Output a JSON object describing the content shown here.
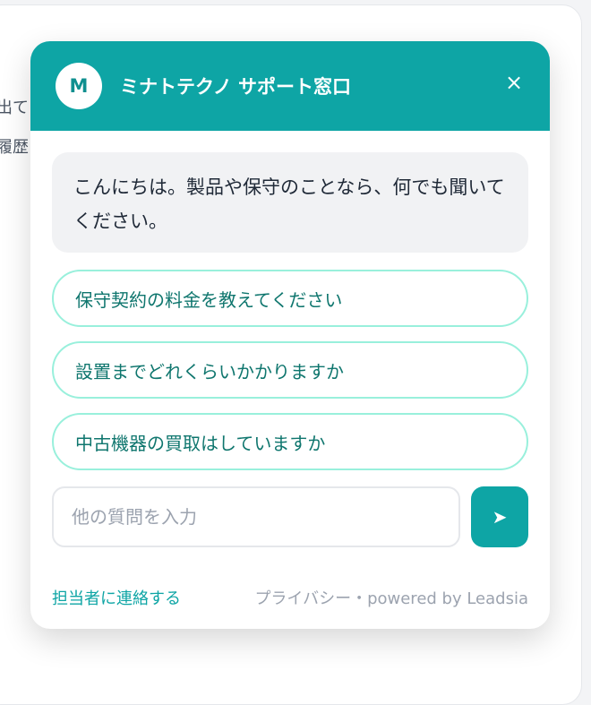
{
  "background": {
    "text_lines": [
      "出て",
      "履歴"
    ]
  },
  "chat": {
    "avatar_letter": "M",
    "title": "ミナトテクノ サポート窓口",
    "close_icon": "×",
    "welcome_message": "こんにちは。製品や保守のことなら、何でも聞いてください。",
    "suggestions": [
      "保守契約の料金を教えてください",
      "設置までどれくらいかかりますか",
      "中古機器の買取はしていますか"
    ],
    "input": {
      "placeholder": "他の質問を入力",
      "value": ""
    },
    "send_icon": "➤",
    "footer": {
      "contact_link": "担当者に連絡する",
      "credits": "プライバシー・powered by Leadsia"
    }
  },
  "colors": {
    "accent": "#0ea5a5",
    "suggestion_border": "#99f0dc",
    "suggestion_text": "#0f766e",
    "bubble_bg": "#f1f2f4"
  }
}
